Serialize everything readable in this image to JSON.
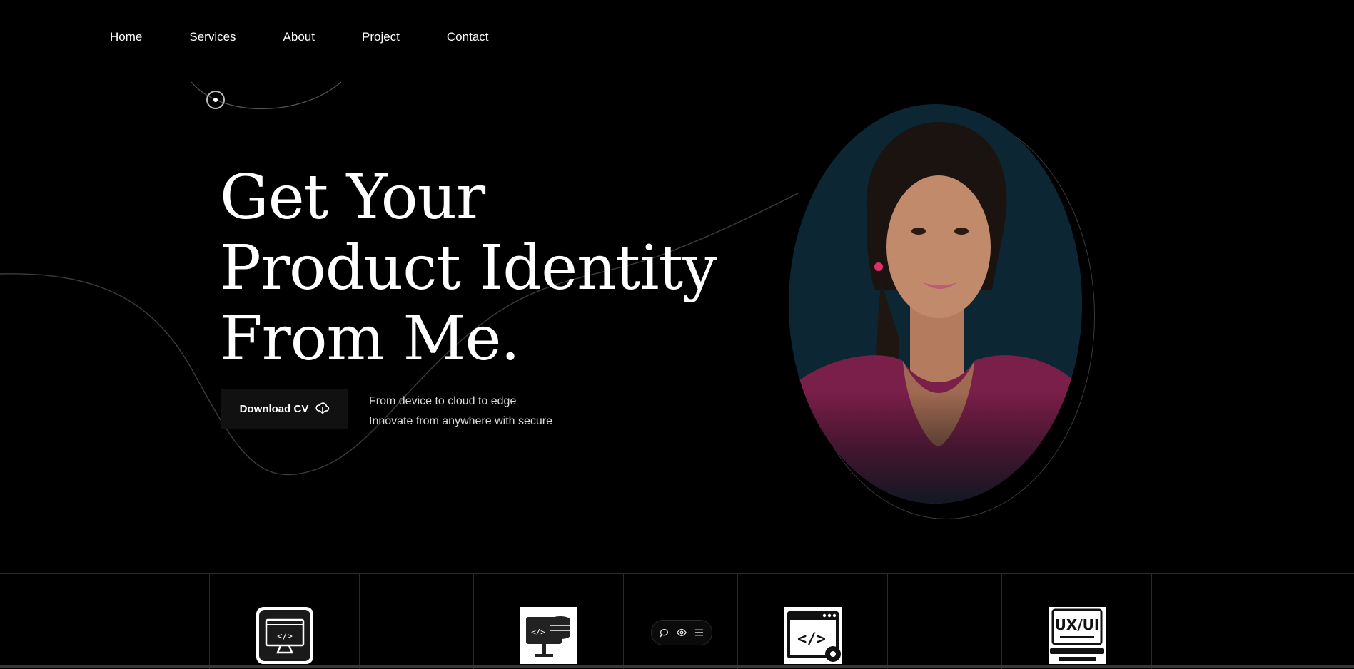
{
  "nav": {
    "items": [
      "Home",
      "Services",
      "About",
      "Project",
      "Contact"
    ]
  },
  "hero": {
    "title_lines": [
      "Get Your",
      "Product Identity",
      "From Me."
    ],
    "download_label": "Download CV",
    "tagline_lines": [
      "From device to cloud to edge",
      "Innovate from anywhere with secure"
    ]
  },
  "services": {
    "icons": [
      "monitor-code-icon",
      "database-monitor-icon",
      "code-window-gear-icon",
      "ux-ui-laptop-icon"
    ]
  },
  "toolbar": {
    "icons": [
      "comment-icon",
      "eye-icon",
      "list-icon"
    ]
  },
  "colors": {
    "background": "#000000",
    "portrait_bg": "#0d2634",
    "accent_text": "#ffffff"
  }
}
